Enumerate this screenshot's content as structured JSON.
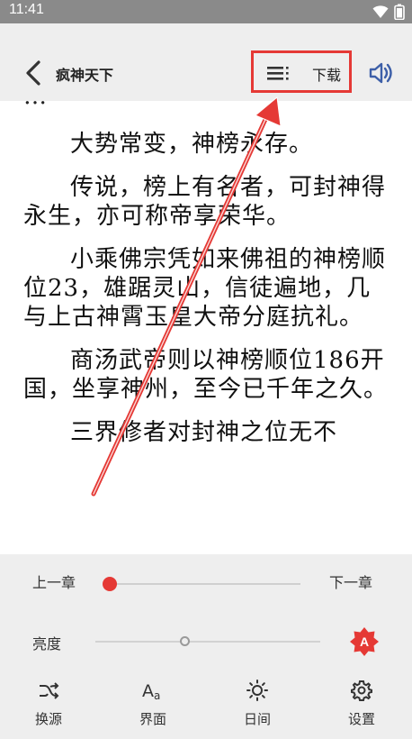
{
  "status": {
    "time": "11:41"
  },
  "header": {
    "title": "疯神天下",
    "download_label": "下载"
  },
  "reader": {
    "cut_line": "…",
    "paragraphs": [
      "大势常变，神榜永存。",
      "传说，榜上有名者，可封神得永生，亦可称帝享荣华。",
      "小乘佛宗凭如来佛祖的神榜顺位23，雄踞灵山，信徒遍地，几与上古神霄玉皇大帝分庭抗礼。",
      "商汤武帝则以神榜顺位186开国，坐享神州，至今已千年之久。",
      "三界修者对封神之位无不"
    ]
  },
  "controls": {
    "prev_chapter": "上一章",
    "next_chapter": "下一章",
    "chapter_progress": 0.0,
    "brightness_label": "亮度",
    "brightness_level": 0.4,
    "auto_brightness_glyph": "A"
  },
  "nav": {
    "items": [
      {
        "label": "换源",
        "icon": "switch-source-icon"
      },
      {
        "label": "界面",
        "icon": "font-style-icon"
      },
      {
        "label": "日间",
        "icon": "sun-icon"
      },
      {
        "label": "设置",
        "icon": "gear-icon"
      }
    ]
  },
  "colors": {
    "accent": "#e53935",
    "panel": "#eeeeee",
    "status_bar": "#8a8a8a"
  }
}
